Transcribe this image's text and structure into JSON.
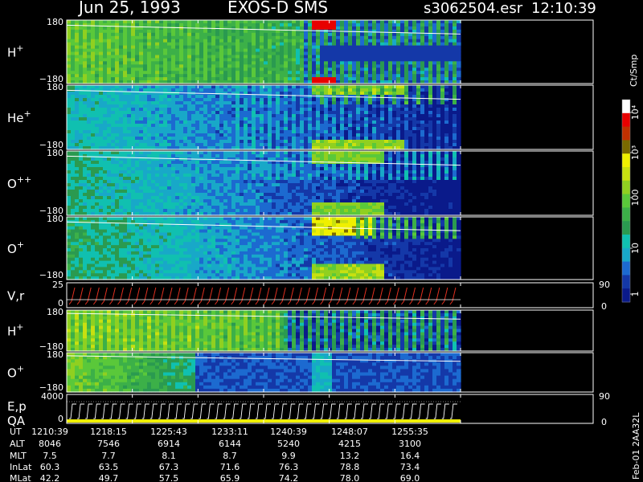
{
  "header": {
    "date": "Jun 25, 1993",
    "instrument": "EXOS-D SMS",
    "file": "s3062504.esr",
    "time": "12:10:39"
  },
  "colors": {
    "palette": [
      "#0a1a8a",
      "#1438a8",
      "#1c6ad0",
      "#18a8c8",
      "#10c0b0",
      "#2a9a50",
      "#3cb048",
      "#5ac83a",
      "#90d020",
      "#c8e010",
      "#f0f000",
      "#7a6a00",
      "#c03000",
      "#e80000",
      "#ffffff"
    ],
    "trace": "#ffffff",
    "vr_trace": "#e03020"
  },
  "colorbar": {
    "unit": "Ct/Smp",
    "tick_labels": [
      "10⁴",
      "10³",
      "100",
      "10",
      "1"
    ]
  },
  "chart_data": {
    "type": "heatmap",
    "time_axis": {
      "labels": [
        "1210:39",
        "1218:15",
        "1225:43",
        "1233:11",
        "1240:39",
        "1248:07",
        "1255:35"
      ],
      "end_of_data_label": "1255:35"
    },
    "panels": [
      {
        "id": "h1",
        "label": "H",
        "sup": "+",
        "ymax": "180",
        "ymin": "−180",
        "pattern": "h"
      },
      {
        "id": "he1",
        "label": "He",
        "sup": "+",
        "ymax": "180",
        "ymin": "−180",
        "pattern": "he"
      },
      {
        "id": "opp",
        "label": "O",
        "sup": "++",
        "ymax": "180",
        "ymin": "−180",
        "pattern": "opp"
      },
      {
        "id": "op1",
        "label": "O",
        "sup": "+",
        "ymax": "180",
        "ymin": "−180",
        "pattern": "op"
      },
      {
        "id": "vr",
        "label": "V,r",
        "sup": "",
        "ymax": "25",
        "ymin": "0",
        "right_top": "90",
        "right_bottom": "0",
        "pattern": "vr"
      },
      {
        "id": "h2",
        "label": "H",
        "sup": "+",
        "ymax": "180",
        "ymin": "−180",
        "pattern": "h2"
      },
      {
        "id": "op2",
        "label": "O",
        "sup": "+",
        "ymax": "180",
        "ymin": "−180",
        "pattern": "op2"
      },
      {
        "id": "ep",
        "label": "E,p",
        "label2": "QA",
        "sup": "",
        "ymax": "4000",
        "ymin": "0",
        "right_top": "90",
        "right_bottom": "0",
        "pattern": "ep"
      }
    ],
    "orbit_table": {
      "rows": [
        {
          "name": "UT",
          "values": [
            "1210:39",
            "1218:15",
            "1225:43",
            "1233:11",
            "1240:39",
            "1248:07",
            "1255:35"
          ]
        },
        {
          "name": "ALT",
          "values": [
            "8046",
            "7546",
            "6914",
            "6144",
            "5240",
            "4215",
            "3100"
          ]
        },
        {
          "name": "MLT",
          "values": [
            "7.5",
            "7.7",
            "8.1",
            "8.7",
            "9.9",
            "13.2",
            "16.4"
          ]
        },
        {
          "name": "InLat",
          "values": [
            "60.3",
            "63.5",
            "67.3",
            "71.6",
            "76.3",
            "78.8",
            "73.4"
          ]
        },
        {
          "name": "MLat",
          "values": [
            "42.2",
            "49.7",
            "57.5",
            "65.9",
            "74.2",
            "78.0",
            "69.0"
          ]
        }
      ]
    }
  },
  "footer": {
    "id_text": "Feb-01 2AA32L"
  }
}
